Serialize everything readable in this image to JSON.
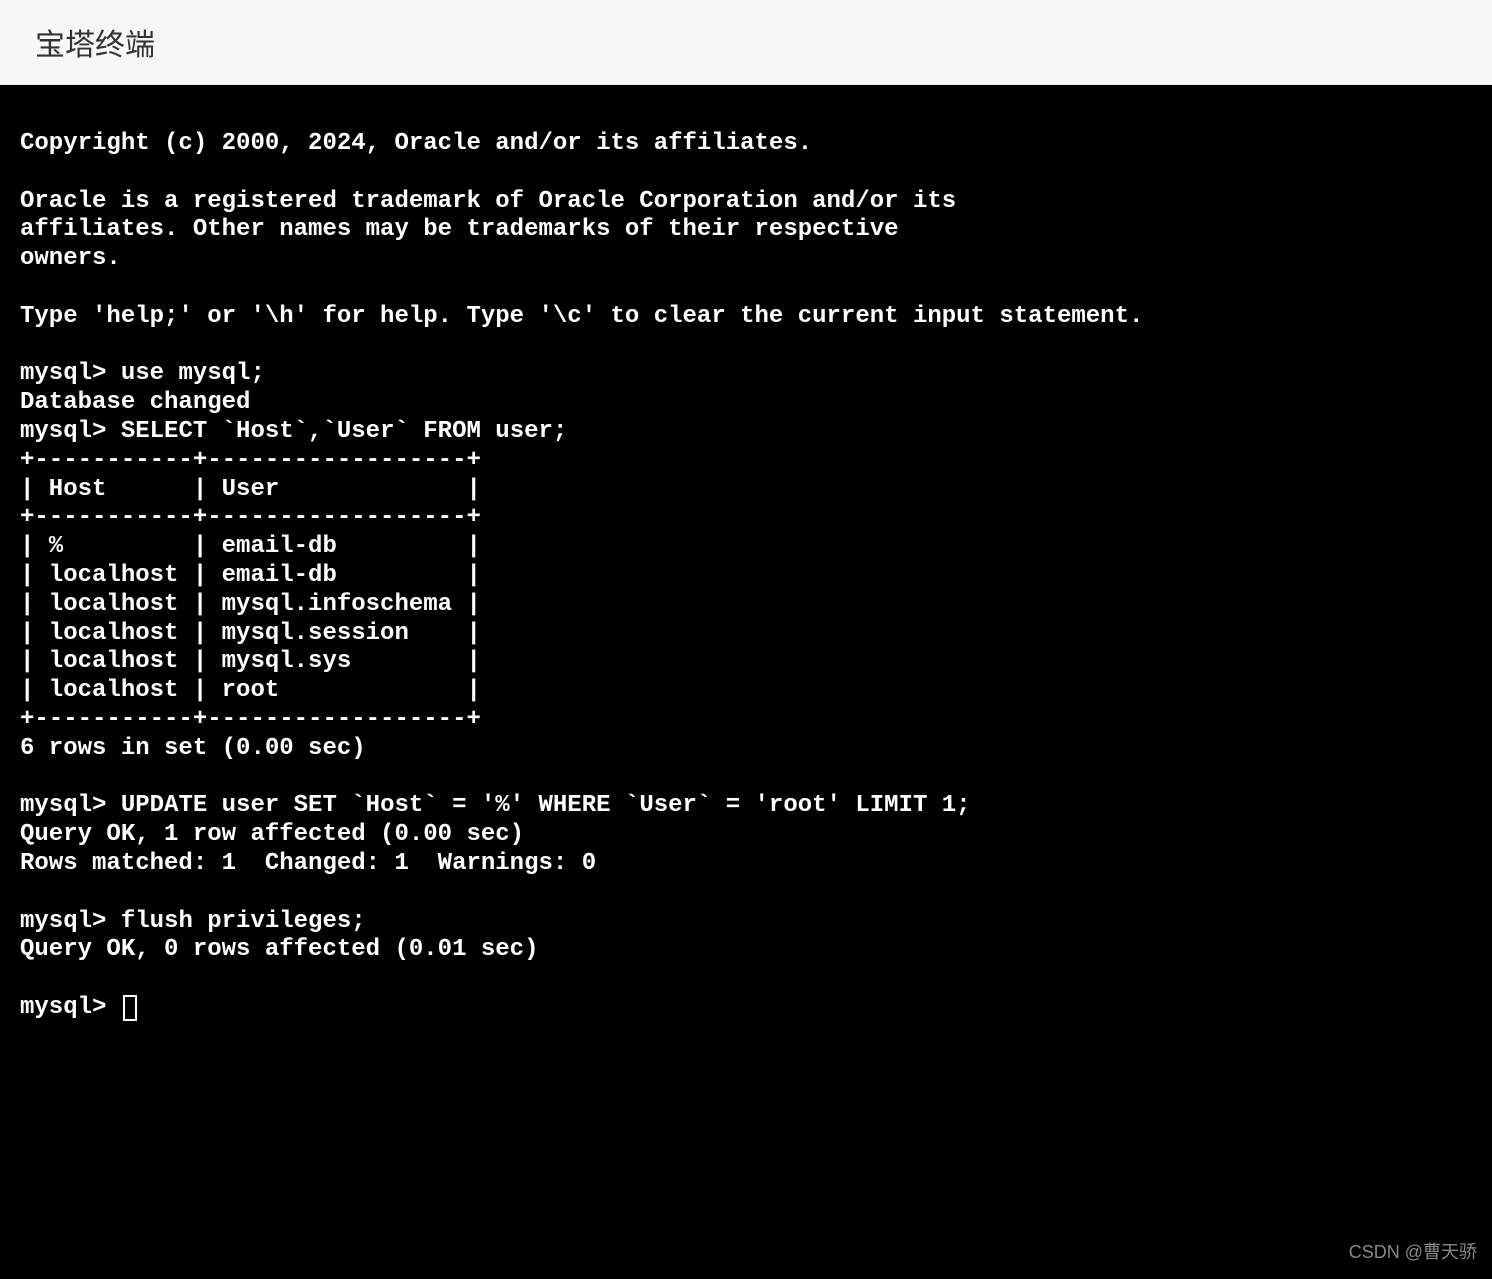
{
  "header": {
    "title": "宝塔终端"
  },
  "terminal": {
    "intro_copyright": "Copyright (c) 2000, 2024, Oracle and/or its affiliates.",
    "intro_trademark": "Oracle is a registered trademark of Oracle Corporation and/or its\naffiliates. Other names may be trademarks of their respective\nowners.",
    "intro_help": "Type 'help;' or '\\h' for help. Type '\\c' to clear the current input statement.",
    "prompt": "mysql> ",
    "cmd1": "use mysql;",
    "out1": "Database changed",
    "cmd2": "SELECT `Host`,`User` FROM user;",
    "table_border_top": "+-----------+------------------+",
    "table_header": "| Host      | User             |",
    "table_border_mid": "+-----------+------------------+",
    "table_rows": [
      "| %         | email-db         |",
      "| localhost | email-db         |",
      "| localhost | mysql.infoschema |",
      "| localhost | mysql.session    |",
      "| localhost | mysql.sys        |",
      "| localhost | root             |"
    ],
    "table_border_bot": "+-----------+------------------+",
    "rows_summary": "6 rows in set (0.00 sec)",
    "cmd3": "UPDATE user SET `Host` = '%' WHERE `User` = 'root' LIMIT 1;",
    "out3a": "Query OK, 1 row affected (0.00 sec)",
    "out3b": "Rows matched: 1  Changed: 1  Warnings: 0",
    "cmd4": "flush privileges;",
    "out4": "Query OK, 0 rows affected (0.01 sec)"
  },
  "watermark": "CSDN @曹天骄"
}
